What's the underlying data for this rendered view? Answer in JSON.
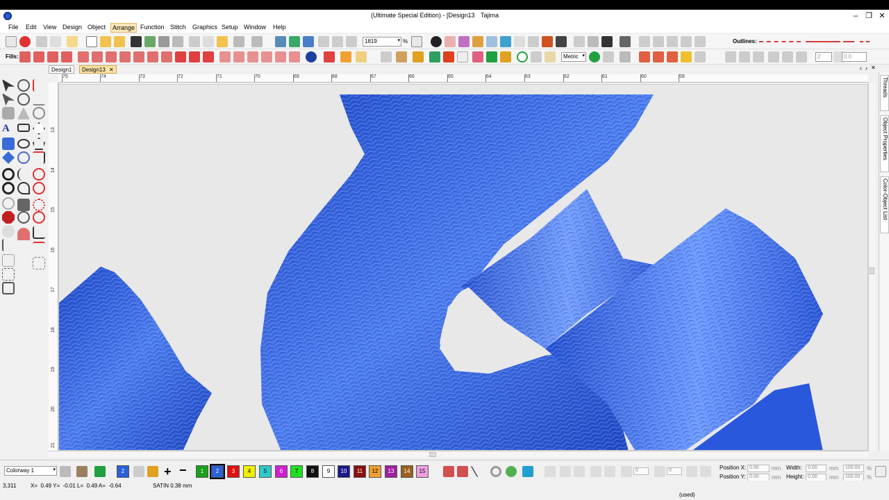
{
  "window": {
    "title": "(Ultimate Special Edition) - [Design13",
    "product": "Tajima",
    "minimize": "–",
    "restore": "❐",
    "close": "✕"
  },
  "menu": [
    "File",
    "Edit",
    "View",
    "Design",
    "Object",
    "Arrange",
    "Function",
    "Stitch",
    "Graphics",
    "Setup",
    "Window",
    "Help"
  ],
  "menu_active": "Arrange",
  "toolbar": {
    "zoom_value": "1819",
    "zoom_unit": "%",
    "outlines_label": "Outlines:",
    "fills_label": "Fills:",
    "units_value": "Metric",
    "spin_value_1": "2",
    "spin_value_2": "0.0"
  },
  "tabs": [
    {
      "label": "Design1",
      "close": "✕"
    },
    {
      "label": "Design13",
      "close": "✕"
    }
  ],
  "tab_nav": {
    "prev": "‹",
    "next": "›",
    "close": "✕"
  },
  "ruler_h": [
    "75",
    "74",
    "73",
    "72",
    "71",
    "70",
    "69",
    "68",
    "67",
    "66",
    "65",
    "64",
    "63",
    "62",
    "61",
    "60",
    "59"
  ],
  "ruler_v": [
    "13",
    "14",
    "15",
    "16",
    "17",
    "18",
    "19",
    "20",
    "21"
  ],
  "side_panels": [
    "Threads",
    "Object Properties",
    "Color-Object List"
  ],
  "colorbar": {
    "colorway": "Colorway 1",
    "current_color": "2",
    "swatches": [
      {
        "n": "1",
        "color": "#1aa01a",
        "text": "#ffffff"
      },
      {
        "n": "2",
        "color": "#2a60d8",
        "text": "#ffffff"
      },
      {
        "n": "3",
        "color": "#e01010",
        "text": "#ffffff"
      },
      {
        "n": "4",
        "color": "#f0f000",
        "text": "#000000"
      },
      {
        "n": "5",
        "color": "#30c8c8",
        "text": "#000000"
      },
      {
        "n": "6",
        "color": "#d020d0",
        "text": "#ffffff"
      },
      {
        "n": "7",
        "color": "#20e020",
        "text": "#000000"
      },
      {
        "n": "8",
        "color": "#111111",
        "text": "#ffffff"
      },
      {
        "n": "9",
        "color": "#ffffff",
        "text": "#000000"
      },
      {
        "n": "10",
        "color": "#1a1a8a",
        "text": "#ffffff"
      },
      {
        "n": "11",
        "color": "#8a1010",
        "text": "#ffffff"
      },
      {
        "n": "12",
        "color": "#f0a030",
        "text": "#000000"
      },
      {
        "n": "13",
        "color": "#a020a0",
        "text": "#ffffff"
      },
      {
        "n": "14",
        "color": "#9a6020",
        "text": "#ffffff"
      },
      {
        "n": "15",
        "color": "#f0a0e0",
        "text": "#000000"
      }
    ],
    "position_x_label": "Position X:",
    "position_y_label": "Position Y:",
    "position_x": "0.00",
    "position_y": "0.00",
    "width_label": "Width:",
    "height_label": "Height:",
    "width": "0.00",
    "height": "0.00",
    "unit": "mm",
    "width_pct": "100.00",
    "height_pct": "100.00",
    "pct": "%"
  },
  "status": {
    "count": "3,311",
    "coords": "X=  0.49 Y=  -0.01 L=  0.49 A=  -0.64",
    "stitch": "SATIN  0.38 mm",
    "license": "(used)"
  },
  "colors": {
    "accent_blue": "#2a60d8",
    "menu_highlight": "#fde6b6",
    "fill_icon_red": "#d63a3a"
  }
}
